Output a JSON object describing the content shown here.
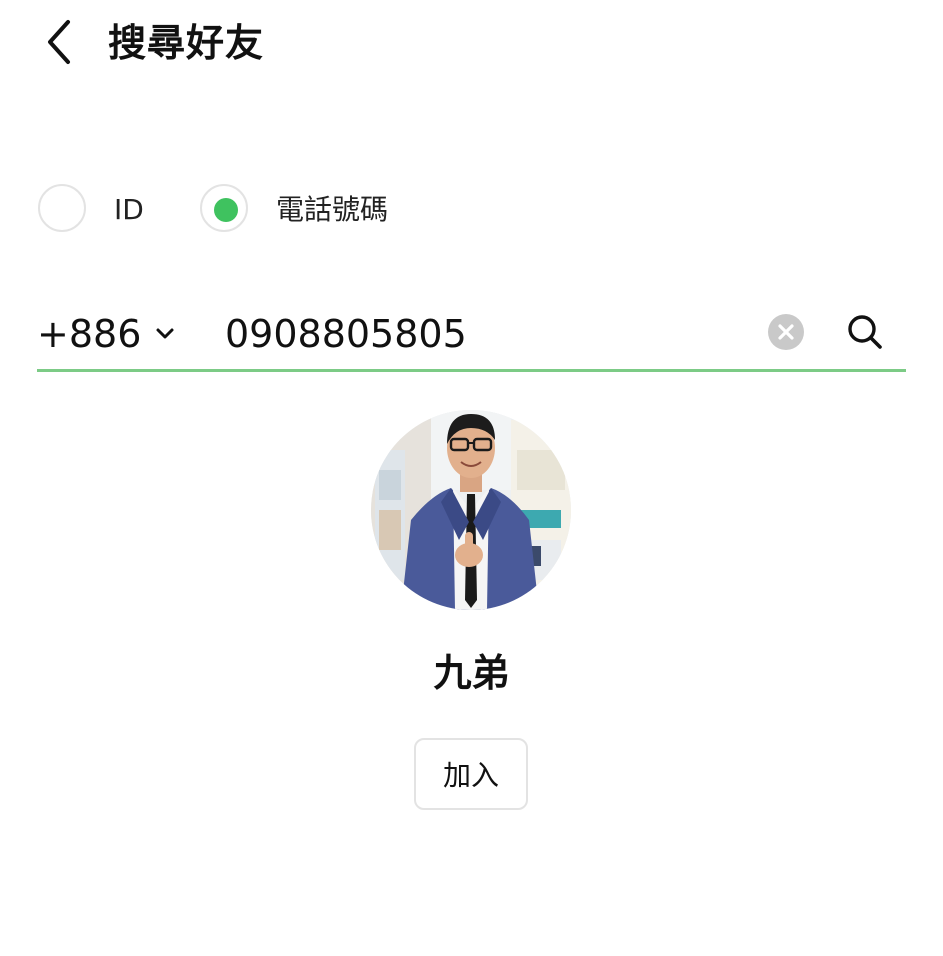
{
  "header": {
    "title": "搜尋好友",
    "back_icon": "chevron-left-icon"
  },
  "search_type": {
    "options": [
      {
        "label": "ID",
        "selected": false
      },
      {
        "label": "電話號碼",
        "selected": true
      }
    ],
    "accent_color": "#3fc25f"
  },
  "search": {
    "country_code": "+886",
    "phone_value": "0908805805",
    "underline_color": "#7ccb86",
    "clear_icon": "clear-circle-icon",
    "search_icon": "search-icon"
  },
  "result": {
    "user_name": "九弟",
    "add_button_label": "加入",
    "avatar": "profile-photo"
  }
}
